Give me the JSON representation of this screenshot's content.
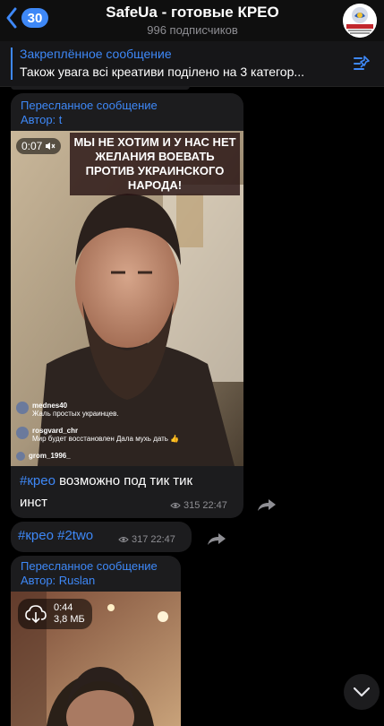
{
  "header": {
    "badge_count": "30",
    "title": "SafeUa - готовые КРЕО",
    "subtitle": "996 подписчиков"
  },
  "pinned": {
    "title": "Закреплённое сообщение",
    "text": "Також увага всі креативи поділено на 3 категор..."
  },
  "messages": [
    {
      "forwarded_label": "Пересланное сообщение",
      "author": "Автор: t",
      "video_time": "0:07",
      "video_caption": "МЫ НЕ ХОТИМ И У НАС НЕТ ЖЕЛАНИЯ ВОЕВАТЬ ПРОТИВ УКРАИНСКОГО НАРОДА!",
      "overlay_comments": [
        {
          "user": "mednes40",
          "text": "Жаль простых украинцев."
        },
        {
          "user": "rosgvard_chr",
          "text": "Мир будет восстановлен Дала мухь дать 👍"
        },
        {
          "user": "grom_1996_",
          "text": ""
        }
      ],
      "hashtag": "#крео",
      "text_rest": " возможно под тик тик",
      "text_line2": "инст",
      "views": "315",
      "time": "22:47"
    },
    {
      "hashtag1": "#крео",
      "hashtag2": "#2two",
      "views": "317",
      "time": "22:47"
    },
    {
      "forwarded_label": "Пересланное сообщение",
      "author": "Автор: Ruslan",
      "duration": "0:44",
      "size": "3,8 МБ"
    }
  ]
}
